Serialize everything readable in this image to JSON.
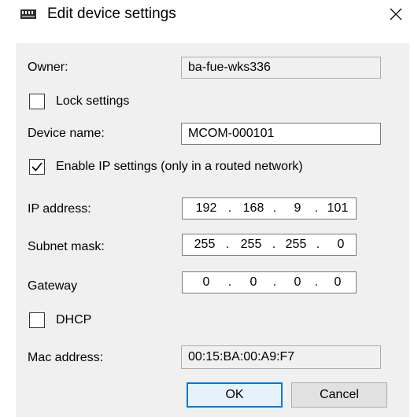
{
  "window": {
    "title": "Edit device settings",
    "icon": "device-icon",
    "close_icon": "close-icon"
  },
  "owner": {
    "label": "Owner:",
    "value": "ba-fue-wks336"
  },
  "lock_settings": {
    "label": "Lock settings",
    "checked": false
  },
  "device_name": {
    "label": "Device name:",
    "value": "MCOM-000101"
  },
  "enable_ip": {
    "label": "Enable IP settings (only in a routed network)",
    "checked": true
  },
  "ip_address": {
    "label": "IP address:",
    "octets": [
      "192",
      "168",
      "9",
      "101"
    ]
  },
  "subnet_mask": {
    "label": "Subnet mask:",
    "octets": [
      "255",
      "255",
      "255",
      "0"
    ]
  },
  "gateway": {
    "label": "Gateway",
    "octets": [
      "0",
      "0",
      "0",
      "0"
    ]
  },
  "dhcp": {
    "label": "DHCP",
    "checked": false
  },
  "mac_address": {
    "label": "Mac address:",
    "value": "00:15:BA:00:A9:F7"
  },
  "buttons": {
    "ok": "OK",
    "cancel": "Cancel"
  },
  "colors": {
    "accent": "#0078d7",
    "dialog_bg": "#f0f0f0"
  }
}
